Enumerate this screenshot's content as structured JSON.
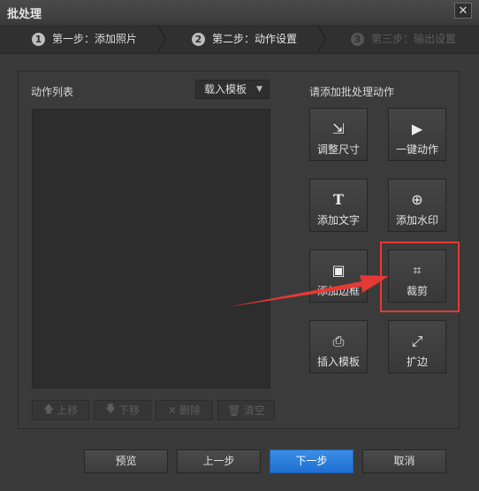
{
  "window": {
    "title": "批处理",
    "close_label": "✕"
  },
  "steps": [
    {
      "num": "1",
      "label": "第一步：添加照片"
    },
    {
      "num": "2",
      "label": "第二步：动作设置"
    },
    {
      "num": "3",
      "label": "第三步：输出设置"
    }
  ],
  "action_list": {
    "label": "动作列表",
    "template_select": "载入模板",
    "buttons": [
      {
        "icon": "arrow-up-icon",
        "glyph": "🡅",
        "label": "上移"
      },
      {
        "icon": "arrow-down-icon",
        "glyph": "🡇",
        "label": "下移"
      },
      {
        "icon": "delete-icon",
        "glyph": "✕",
        "label": "删除"
      },
      {
        "icon": "trash-icon",
        "glyph": "🗑",
        "label": "清空"
      }
    ]
  },
  "actions": {
    "label": "请添加批处理动作",
    "tools": [
      {
        "icon": "resize-icon",
        "glyph": "⇲",
        "label": "调整尺寸"
      },
      {
        "icon": "play-icon",
        "glyph": "▶",
        "label": "一键动作"
      },
      {
        "icon": "text-icon",
        "glyph": "T",
        "label": "添加文字"
      },
      {
        "icon": "watermark-icon",
        "glyph": "⊕",
        "label": "添加水印"
      },
      {
        "icon": "border-icon",
        "glyph": "▣",
        "label": "添加边框"
      },
      {
        "icon": "crop-icon",
        "glyph": "⌗",
        "label": "裁剪"
      },
      {
        "icon": "template-icon",
        "glyph": "⎙",
        "label": "插入模板"
      },
      {
        "icon": "expand-icon",
        "glyph": "⤢",
        "label": "扩边"
      }
    ]
  },
  "footer": {
    "preview": "预览",
    "prev": "上一步",
    "next": "下一步",
    "cancel": "取消"
  },
  "colors": {
    "annotation": "#e53935",
    "primary": "#1f6fd1"
  }
}
